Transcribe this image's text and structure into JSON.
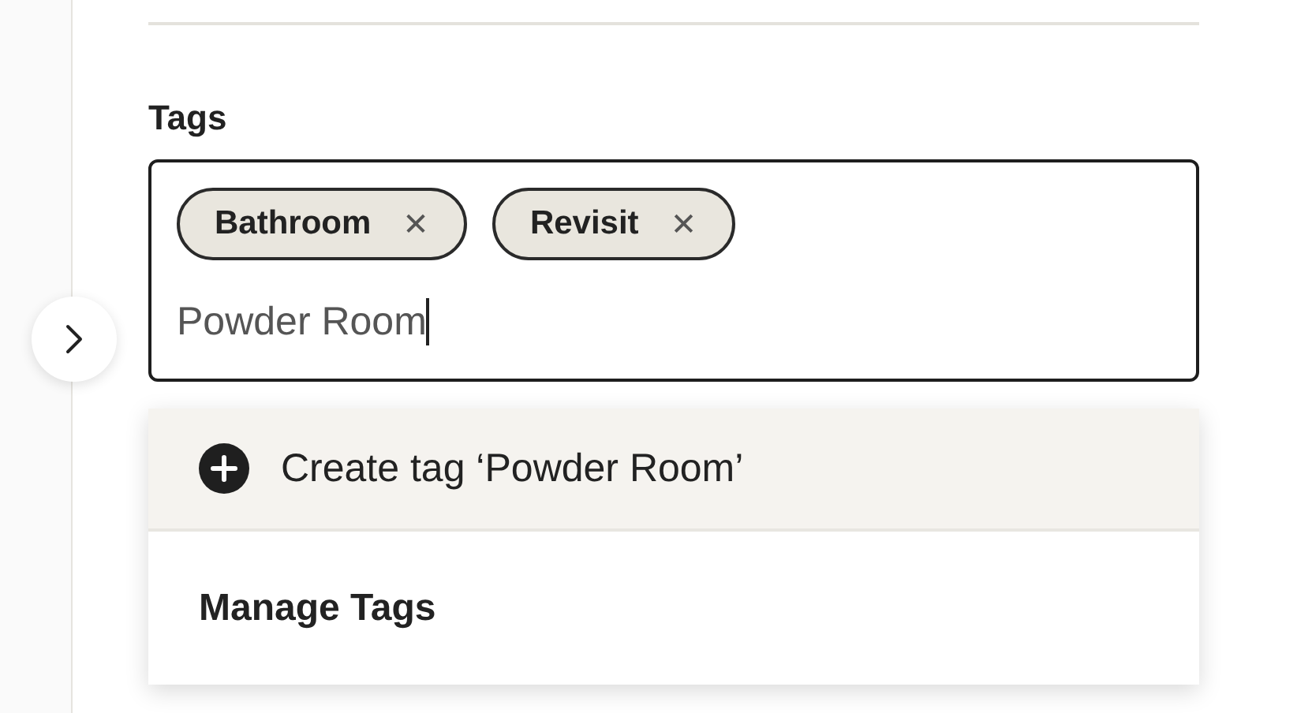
{
  "field": {
    "label": "Tags",
    "tags": [
      {
        "label": "Bathroom",
        "remove": "✕"
      },
      {
        "label": "Revisit",
        "remove": "✕"
      }
    ],
    "value": "Powder Room"
  },
  "dropdown": {
    "options": [
      {
        "kind": "create",
        "label": "Create tag ‘Powder Room’",
        "highlighted": true
      },
      {
        "kind": "manage",
        "label": "Manage Tags",
        "highlighted": false
      }
    ]
  }
}
